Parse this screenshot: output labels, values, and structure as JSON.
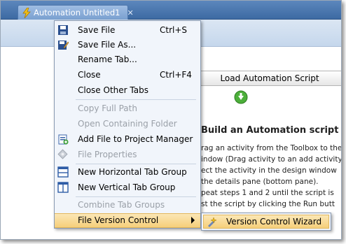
{
  "tab": {
    "title": "Automation Untitled1",
    "close": "✕"
  },
  "main": {
    "load_button": "Load Automation Script",
    "heading": "Build an Automation script",
    "instructions": [
      "rag an activity from the Toolbox to the",
      "indow (Drag activity to an add activity",
      "ect the activity in the design window",
      "the details pane (bottom pane).",
      "peat steps 1 and 2 until the script is",
      "st the script by clicking the Run butt"
    ]
  },
  "context_menu": {
    "items": [
      {
        "label": "Save File",
        "shortcut": "Ctrl+S",
        "icon": "floppy-disk-icon",
        "disabled": false
      },
      {
        "label": "Save File As...",
        "shortcut": "",
        "icon": "save-as-icon",
        "disabled": false
      },
      {
        "label": "Rename Tab...",
        "shortcut": "",
        "icon": "",
        "disabled": false
      },
      {
        "label": "Close",
        "shortcut": "Ctrl+F4",
        "icon": "",
        "disabled": false
      },
      {
        "label": "Close Other Tabs",
        "shortcut": "",
        "icon": "",
        "disabled": false
      },
      {
        "label": "Copy Full Path",
        "shortcut": "",
        "icon": "",
        "disabled": true
      },
      {
        "label": "Open Containing Folder",
        "shortcut": "",
        "icon": "",
        "disabled": true
      },
      {
        "label": "Add File to Project Manager",
        "shortcut": "",
        "icon": "add-to-project-icon",
        "disabled": false
      },
      {
        "label": "File Properties",
        "shortcut": "",
        "icon": "properties-icon",
        "disabled": true
      },
      {
        "label": "New Horizontal Tab Group",
        "shortcut": "",
        "icon": "horizontal-tab-group-icon",
        "disabled": false
      },
      {
        "label": "New Vertical Tab Group",
        "shortcut": "",
        "icon": "vertical-tab-group-icon",
        "disabled": false
      },
      {
        "label": "Combine Tab Groups",
        "shortcut": "",
        "icon": "",
        "disabled": true
      },
      {
        "label": "File Version Control",
        "shortcut": "",
        "icon": "",
        "disabled": false,
        "highlighted": true
      }
    ]
  },
  "submenu": {
    "items": [
      {
        "label": "Version Control Wizard",
        "icon": "version-control-wizard-icon"
      }
    ]
  },
  "colors": {
    "tab_strip": "#4b77b0",
    "menu_bg": "#f1f5fb",
    "highlight": "#f6cf7a",
    "disabled_text": "#9aa0a8"
  }
}
